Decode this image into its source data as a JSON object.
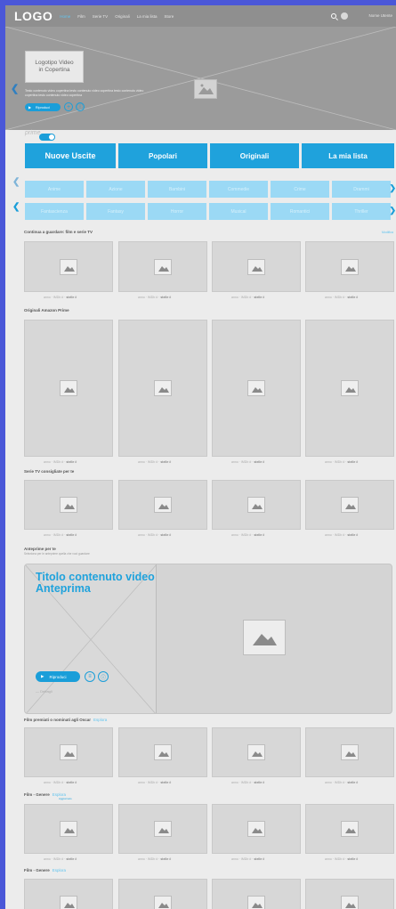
{
  "nav": {
    "logo": "LOGO",
    "links": [
      "Home",
      "Film",
      "Serie TV",
      "Originali",
      "La mia lista",
      "Store"
    ],
    "username": "Nome Utente",
    "search_icon": "search-icon",
    "avatar_icon": "avatar"
  },
  "hero": {
    "logo_text": "Logotipo Video\nin Copertina",
    "description": "Testo contenuto video copertina testo contenuto video copertina testo contenuto video copertina testo contenuto video copertina",
    "play_label": "Riproduci",
    "add_icon": "plus-icon",
    "info_icon": "info-icon"
  },
  "prime": {
    "label": "prime"
  },
  "tabs": [
    "Nuove Uscite",
    "Popolari",
    "Originali",
    "La mia lista"
  ],
  "genres_row1": [
    "Anime",
    "Azione",
    "Bambini",
    "Commedie",
    "Crime",
    "Drammi"
  ],
  "genres_row2": [
    "Fantascienza",
    "Fantasy",
    "Horror",
    "Musical",
    "Romantici",
    "Thriller"
  ],
  "card_meta": {
    "year": "anno",
    "imdb": "IMDb #",
    "stars": "stelle #"
  },
  "sections": {
    "continue": {
      "title": "Continua a guardare: film e serie TV",
      "more": "Modifica"
    },
    "originals": {
      "title": "Originali Amazon Prime"
    },
    "series": {
      "title": "Serie TV consigliate per te"
    },
    "preview": {
      "title": "Anteprime per te",
      "subtitle": "Seleziona per le anteprime quella che vuoi guardare",
      "video_title": "Titolo contenuto video Anteprima",
      "play_label": "Riproduci",
      "more_label": "Dettagli"
    },
    "oscar": {
      "title": "Film premiati o nominati agli Oscar",
      "link": "Esplora"
    },
    "genre1": {
      "title": "Film - Genere",
      "link": "Esplora",
      "badge": "Aggiornato"
    },
    "genre2": {
      "title": "Film - Genere",
      "link": "Esplora"
    }
  },
  "colors": {
    "accent": "#1fa2dc",
    "genre": "#9bd9f5",
    "background": "#4a57d8",
    "nav": "#8f8f8f"
  }
}
